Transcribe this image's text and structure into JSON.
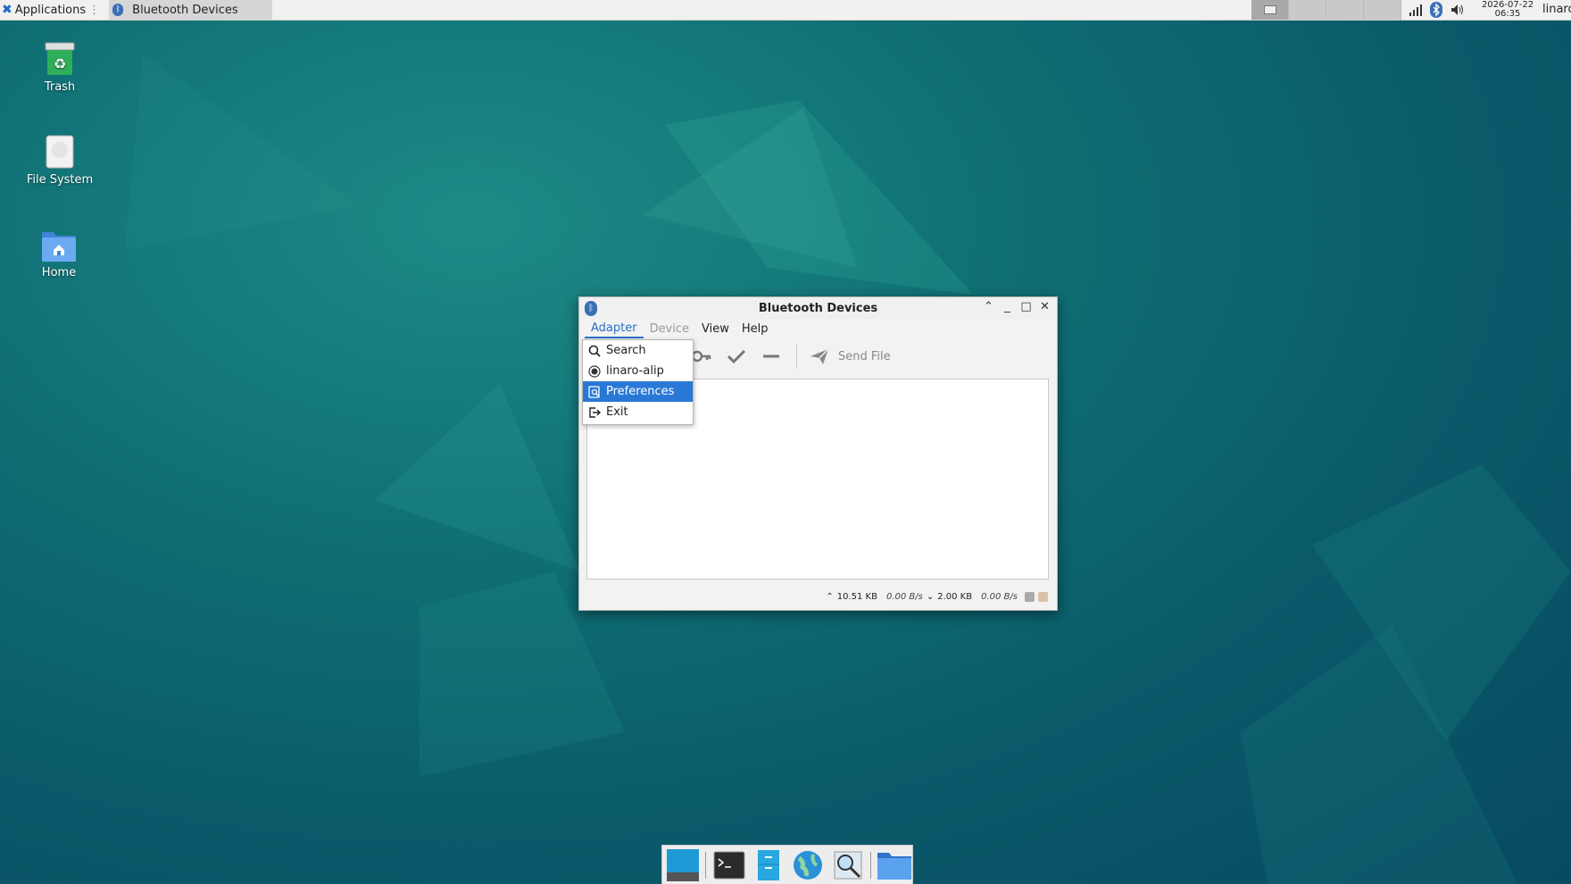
{
  "top_panel": {
    "applications_label": "Applications",
    "task_label": "Bluetooth Devices",
    "clock_date": "2026-07-22",
    "clock_time": "06:35",
    "user_label": "linaro"
  },
  "desktop_icons": [
    {
      "label": "Trash"
    },
    {
      "label": "File System"
    },
    {
      "label": "Home"
    }
  ],
  "window": {
    "title": "Bluetooth Devices",
    "menus": {
      "adapter": "Adapter",
      "device": "Device",
      "view": "View",
      "help": "Help"
    },
    "toolbar": {
      "send_file_label": "Send File"
    },
    "status": {
      "upload_total": "10.51 KB",
      "upload_rate": "0.00 B/s",
      "download_total": "2.00 KB",
      "download_rate": "0.00 B/s"
    }
  },
  "adapter_menu": {
    "items": [
      {
        "label": "Search",
        "icon": "search-icon"
      },
      {
        "label": "linaro-alip",
        "icon": "radio-icon"
      },
      {
        "label": "Preferences",
        "icon": "preferences-icon",
        "highlighted": true
      },
      {
        "label": "Exit",
        "icon": "exit-icon"
      }
    ]
  },
  "colors": {
    "highlight": "#2a78d6",
    "accent_blue": "#2a6fc9",
    "desktop": "#0f6f74"
  }
}
